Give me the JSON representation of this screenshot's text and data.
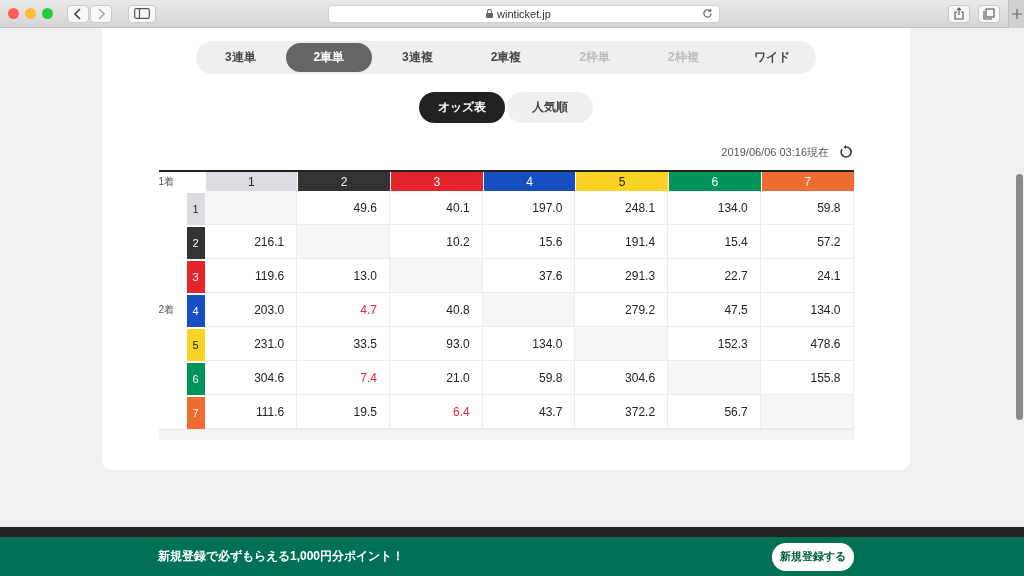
{
  "browser": {
    "url": "winticket.jp"
  },
  "bet_types": [
    {
      "label": "3連単",
      "selected": false,
      "disabled": false
    },
    {
      "label": "2車単",
      "selected": true,
      "disabled": false
    },
    {
      "label": "3連複",
      "selected": false,
      "disabled": false
    },
    {
      "label": "2車複",
      "selected": false,
      "disabled": false
    },
    {
      "label": "2枠単",
      "selected": false,
      "disabled": true
    },
    {
      "label": "2枠複",
      "selected": false,
      "disabled": true
    },
    {
      "label": "ワイド",
      "selected": false,
      "disabled": false
    }
  ],
  "views": [
    {
      "label": "オッズ表",
      "selected": true
    },
    {
      "label": "人気順",
      "selected": false
    }
  ],
  "timestamp": "2019/06/06 03:16現在",
  "table": {
    "column_label": "1着",
    "row_label": "2着",
    "columns": [
      {
        "label": "1",
        "color": "#dcdde2"
      },
      {
        "label": "2",
        "color": "#333333"
      },
      {
        "label": "3",
        "color": "#e3262b"
      },
      {
        "label": "4",
        "color": "#1650c0"
      },
      {
        "label": "5",
        "color": "#fcd224"
      },
      {
        "label": "6",
        "color": "#00935a"
      },
      {
        "label": "7",
        "color": "#ef6c30"
      }
    ],
    "rows": [
      {
        "label": "1",
        "color": "#dcdde2",
        "cells": [
          {
            "kind": "empty"
          },
          {
            "kind": "odds",
            "value": "49.6",
            "hot": false
          },
          {
            "kind": "odds",
            "value": "40.1",
            "hot": false
          },
          {
            "kind": "odds",
            "value": "197.0",
            "hot": false
          },
          {
            "kind": "odds",
            "value": "248.1",
            "hot": false
          },
          {
            "kind": "odds",
            "value": "134.0",
            "hot": false
          },
          {
            "kind": "odds",
            "value": "59.8",
            "hot": false
          }
        ]
      },
      {
        "label": "2",
        "color": "#333333",
        "cells": [
          {
            "kind": "odds",
            "value": "216.1",
            "hot": false
          },
          {
            "kind": "empty"
          },
          {
            "kind": "odds",
            "value": "10.2",
            "hot": false
          },
          {
            "kind": "odds",
            "value": "15.6",
            "hot": false
          },
          {
            "kind": "odds",
            "value": "191.4",
            "hot": false
          },
          {
            "kind": "odds",
            "value": "15.4",
            "hot": false
          },
          {
            "kind": "odds",
            "value": "57.2",
            "hot": false
          }
        ]
      },
      {
        "label": "3",
        "color": "#e3262b",
        "cells": [
          {
            "kind": "odds",
            "value": "119.6",
            "hot": false
          },
          {
            "kind": "odds",
            "value": "13.0",
            "hot": false
          },
          {
            "kind": "empty"
          },
          {
            "kind": "odds",
            "value": "37.6",
            "hot": false
          },
          {
            "kind": "odds",
            "value": "291.3",
            "hot": false
          },
          {
            "kind": "odds",
            "value": "22.7",
            "hot": false
          },
          {
            "kind": "odds",
            "value": "24.1",
            "hot": false
          }
        ]
      },
      {
        "label": "4",
        "color": "#1650c0",
        "cells": [
          {
            "kind": "odds",
            "value": "203.0",
            "hot": false
          },
          {
            "kind": "odds",
            "value": "4.7",
            "hot": true
          },
          {
            "kind": "odds",
            "value": "40.8",
            "hot": false
          },
          {
            "kind": "empty"
          },
          {
            "kind": "odds",
            "value": "279.2",
            "hot": false
          },
          {
            "kind": "odds",
            "value": "47.5",
            "hot": false
          },
          {
            "kind": "odds",
            "value": "134.0",
            "hot": false
          }
        ]
      },
      {
        "label": "5",
        "color": "#fcd224",
        "cells": [
          {
            "kind": "odds",
            "value": "231.0",
            "hot": false
          },
          {
            "kind": "odds",
            "value": "33.5",
            "hot": false
          },
          {
            "kind": "odds",
            "value": "93.0",
            "hot": false
          },
          {
            "kind": "odds",
            "value": "134.0",
            "hot": false
          },
          {
            "kind": "empty"
          },
          {
            "kind": "odds",
            "value": "152.3",
            "hot": false
          },
          {
            "kind": "odds",
            "value": "478.6",
            "hot": false
          }
        ]
      },
      {
        "label": "6",
        "color": "#00935a",
        "cells": [
          {
            "kind": "odds",
            "value": "304.6",
            "hot": false
          },
          {
            "kind": "odds",
            "value": "7.4",
            "hot": true
          },
          {
            "kind": "odds",
            "value": "21.0",
            "hot": false
          },
          {
            "kind": "odds",
            "value": "59.8",
            "hot": false
          },
          {
            "kind": "odds",
            "value": "304.6",
            "hot": false
          },
          {
            "kind": "empty"
          },
          {
            "kind": "odds",
            "value": "155.8",
            "hot": false
          }
        ]
      },
      {
        "label": "7",
        "color": "#ef6c30",
        "cells": [
          {
            "kind": "odds",
            "value": "111.6",
            "hot": false
          },
          {
            "kind": "odds",
            "value": "19.5",
            "hot": false
          },
          {
            "kind": "odds",
            "value": "6.4",
            "hot": true
          },
          {
            "kind": "odds",
            "value": "43.7",
            "hot": false
          },
          {
            "kind": "odds",
            "value": "372.2",
            "hot": false
          },
          {
            "kind": "odds",
            "value": "56.7",
            "hot": false
          },
          {
            "kind": "empty"
          }
        ]
      }
    ]
  },
  "banner": {
    "text": "新規登録で必ずもらえる1,000円分ポイント！",
    "button": "新規登録する"
  }
}
